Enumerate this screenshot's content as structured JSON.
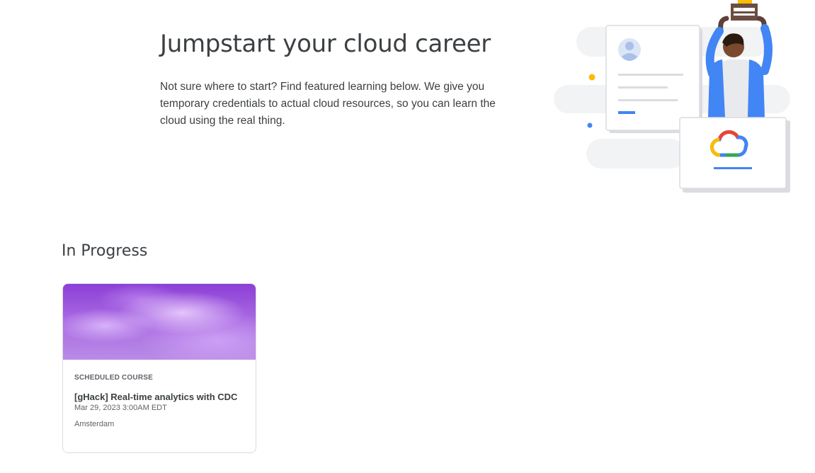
{
  "hero": {
    "title": "Jumpstart your cloud career",
    "description": "Not sure where to start? Find featured learning below. We give you temporary credentials to actual cloud resources, so you can learn the cloud using the real thing."
  },
  "illustration": {
    "icon": "person-holding-trophy-with-google-cloud-logo",
    "colors": {
      "blue": "#4285f4",
      "red": "#ea4335",
      "yellow": "#fbbc04",
      "green": "#34a853"
    }
  },
  "in_progress": {
    "title": "In Progress",
    "cards": [
      {
        "type": "SCHEDULED COURSE",
        "title": "[gHack] Real-time analytics with CDC",
        "date": "Mar 29, 2023 3:00AM EDT",
        "location": "Amsterdam"
      }
    ]
  }
}
